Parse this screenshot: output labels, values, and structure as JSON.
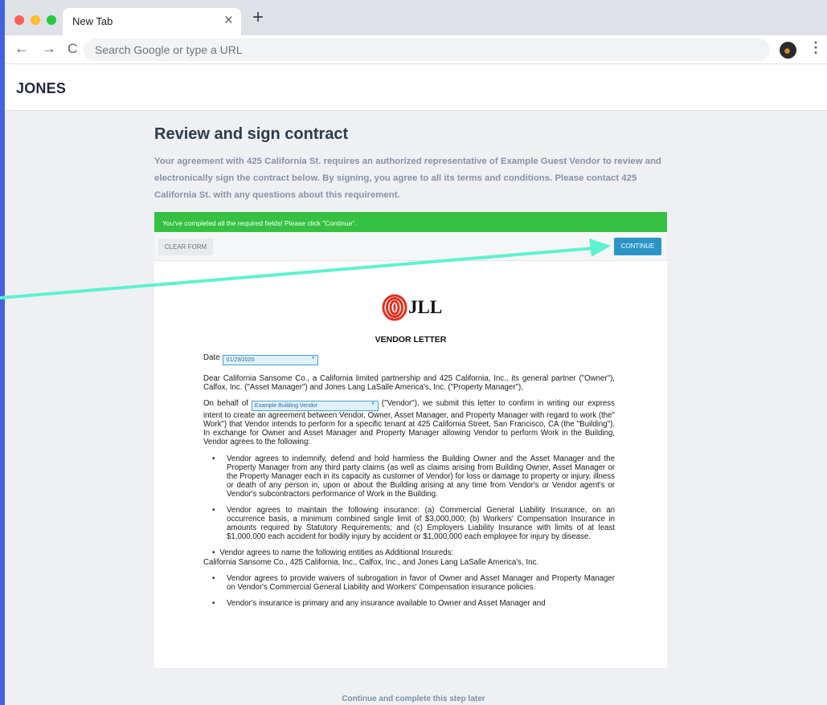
{
  "browser": {
    "tab_title": "New Tab",
    "tab_close": "×",
    "new_tab": "+",
    "back": "←",
    "forward": "→",
    "reload": "C",
    "omnibox_placeholder": "Search Google or type a URL",
    "menu": "⋮"
  },
  "app": {
    "brand": "JONES"
  },
  "page": {
    "title": "Review and sign contract",
    "description": "Your agreement with 425 California St. requires an authorized representative of Example Guest Vendor to review and electronically sign the contract below. By signing, you agree to all its terms and conditions. Please contact 425 California St. with any questions about this requirement."
  },
  "banner": {
    "message": "You've completed all the required fields! Please click \"Continue\"."
  },
  "actions": {
    "clear_label": "CLEAR FORM",
    "continue_label": "CONTINUE"
  },
  "document": {
    "logo_text": "JLL",
    "title": "VENDOR LETTER",
    "date_label": "Date",
    "date_value": "01/29/2020",
    "required_mark": "*",
    "salutation": "Dear California Sansome Co., a California limited partnership and 425 California, Inc., its general partner (\"Owner\"), Calfox, Inc. (\"Asset Manager\") and Jones Lang LaSalle America's, Inc. (\"Property Manager\"),",
    "behalf_prefix": "On behalf of",
    "vendor_value": "Example Building Vendor",
    "behalf_rest": "(\"Vendor\"), we submit this letter to confirm in writing our express intent to create an agreement between Vendor, Owner, Asset Manager, and Property Manager with regard to work (the\" Work\") that Vendor intends to perform for a specific tenant at 425 California Street, San Francisco, CA (the \"Building\"). In exchange for Owner and Asset Manager and Property Manager allowing Vendor to perform Work in the Building, Vendor agrees to the following:",
    "bullet_char": "•",
    "bullets": [
      "Vendor agrees to indemnify, defend and hold harmless the Building Owner and the Asset Manager and the Property Manager from any third party claims (as well as claims arising from Building Owner, Asset Manager or the Property Manager each in its capacity as customer of Vendor) for loss or damage to property or injury, illness or death of any person in, upon or about the Building arising at any time from Vendor's or Vendor agent's or Vendor's subcontractors performance of Work in the Building.",
      "Vendor agrees to maintain the following insurance: (a) Commercial General Liability Insurance, on an occurrence basis, a minimum combined single limit of $3,000,000; (b) Workers' Compensation Insurance in amounts required by Statutory Requirements; and (c) Employers Liability Insurance with limits of at least $1,000,000 each accident for bodily injury by accident or $1,000,000 each employee for injury by disease."
    ],
    "insured_bullet": "Vendor agrees to name the following entities as Additional Insureds:",
    "insured_list": "California Sansome Co., 425 California, Inc., Calfox, Inc., and Jones Lang LaSalle America's, Inc.",
    "bullets_after": [
      "Vendor agrees to provide waivers of subrogation in favor of Owner and Asset Manager and Property Manager on Vendor's Commercial General Liability and Workers' Compensation insurance policies.",
      "Vendor's insurance is primary and any insurance available to Owner and Asset Manager and"
    ]
  },
  "footer": {
    "later_link": "Continue and complete this step later"
  },
  "colors": {
    "arrow": "#5ef2cf",
    "banner": "#35c142",
    "continue": "#2b94c6",
    "desktop": "#4361e0"
  }
}
